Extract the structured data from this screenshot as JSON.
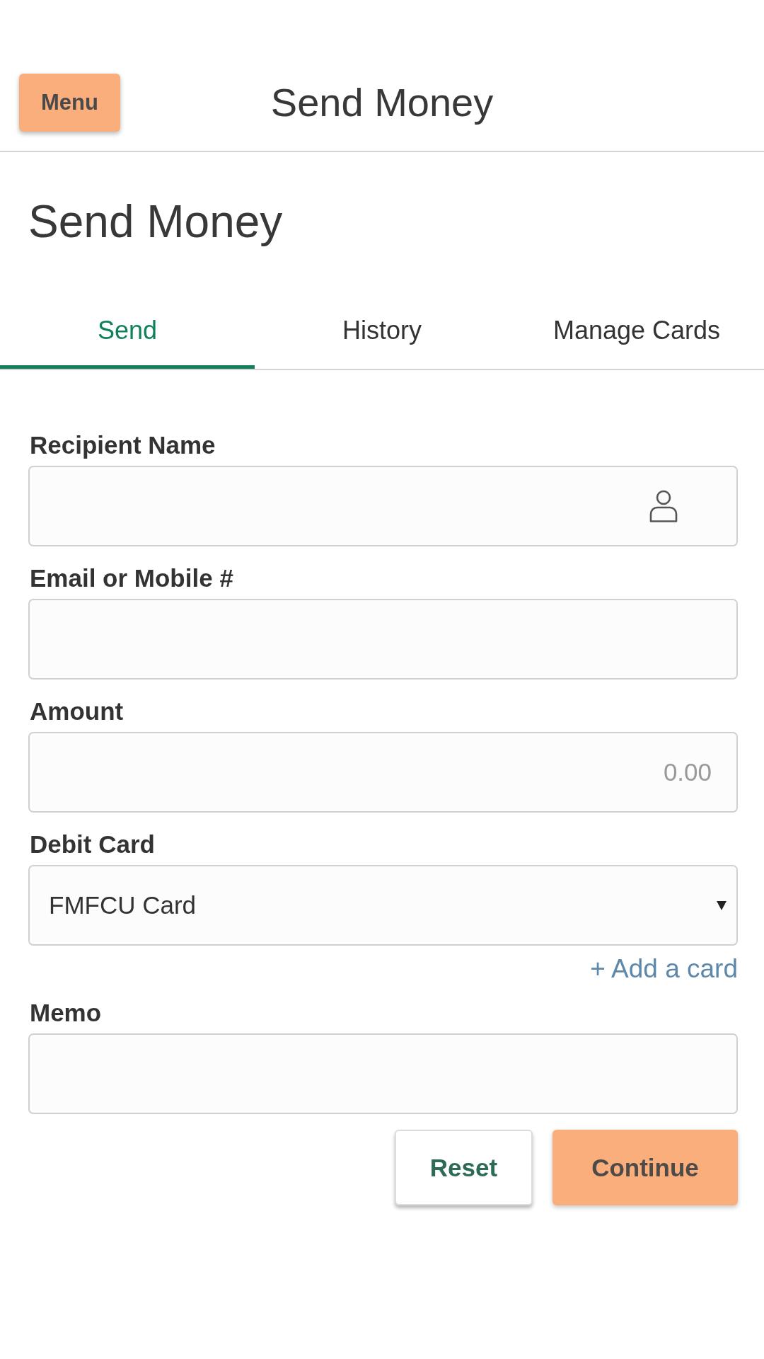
{
  "header": {
    "menu_button": "Menu",
    "title": "Send Money"
  },
  "page_title": "Send Money",
  "tabs": [
    {
      "label": "Send",
      "selected": true
    },
    {
      "label": "History",
      "selected": false
    },
    {
      "label": "Manage Cards",
      "selected": false
    }
  ],
  "form": {
    "fields": [
      {
        "kind": "contact",
        "label": "Recipient Name"
      },
      {
        "kind": "text",
        "label": "Email or Mobile #"
      },
      {
        "kind": "amount",
        "label": "Amount",
        "placeholder": "0.00"
      },
      {
        "kind": "select",
        "label": "Debit Card",
        "value": "FMFCU Card",
        "link": "+ Add a card"
      },
      {
        "kind": "text",
        "label": "Memo"
      }
    ],
    "buttons": [
      {
        "kind": "secondary",
        "label": "Reset"
      },
      {
        "kind": "primary",
        "label": "Continue"
      }
    ]
  }
}
